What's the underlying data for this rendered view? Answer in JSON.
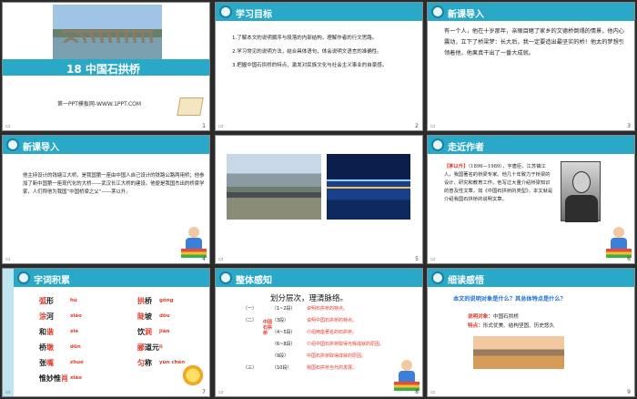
{
  "slide1": {
    "title": "18  中国石拱桥",
    "site": "第一PPT模板网-WWW.1PPT.COM",
    "num": "1"
  },
  "slide2": {
    "heading": "学习目标",
    "num": "2",
    "items": [
      "1.了解本文的说明顺序与段落的内部结构，理解作者的行文思路。",
      "2.学习常见的说明方法，结合具体语句，体会说明文语言的准确性。",
      "3.把握中国石拱桥的特点，激发对民族文化与社会主义事业的自豪感。"
    ]
  },
  "slide3": {
    "heading": "新课导入",
    "num": "3",
    "para": "有一个人，他在十岁那年，亲眼目睹了家乡的文德桥倒塌的情景，他内心震动，立下了桥梁梦：长大后，我一定要造出最坚实的桥！他太的梦想引领着他，他果真干出了一番大成就。"
  },
  "slide4": {
    "heading": "新课导入",
    "num": "4",
    "para": "他主持设计的钱塘江大桥，是我国第一座由中国人自己设计的铁路公路两用桥；他参加了新中国第一座现代化的大桥——武汉长江大桥的建设。他便是我国杰出的桥梁学家，人们称他为我国“中国桥梁之父”——茅以升。"
  },
  "slide5": {
    "num": "5"
  },
  "slide6": {
    "heading": "走近作者",
    "num": "6",
    "tag": "【茅以升】",
    "para": "（1896—1989），字唐臣，江苏镇江人，我国著名的桥梁专家。他几十年致力于桥梁的设计、研究和教育工作。他写过大量介绍桥梁知识的普及性文章，如《中国石拱桥的类型》，本文就是介绍我国石拱桥的说明文章。"
  },
  "slide7": {
    "heading": "字词积累",
    "num": "7",
    "left": [
      {
        "w": "弧形",
        "r": "弧",
        "p": "hú"
      },
      {
        "w": "涂河",
        "r": "涂",
        "p": "xiáo"
      },
      {
        "w": "和谐",
        "r": "谐",
        "p": "xié"
      },
      {
        "w": "桥墩",
        "r": "墩",
        "p": "dūn"
      },
      {
        "w": "张嘴",
        "r": "嘴",
        "p": "zhuó"
      },
      {
        "w": "惟妙惟肖",
        "r": "肖",
        "p": "xiào"
      }
    ],
    "right": [
      {
        "w": "拱桥",
        "r": "拱",
        "p": "gǒng"
      },
      {
        "w": "陡坡",
        "r": "陡",
        "p": "dǒu"
      },
      {
        "w": "饮涧",
        "r": "涧",
        "p": "jiàn"
      },
      {
        "w": "郦道元",
        "r": "郦",
        "p": "lì"
      },
      {
        "w": "匀称",
        "r": "匀",
        "p": "yún chèn"
      }
    ]
  },
  "slide8": {
    "heading": "整体感知",
    "num": "8",
    "head": "划分层次，理清脉络。",
    "vert": "中国石拱桥",
    "rows": [
      {
        "a": "（一）",
        "b": "（1~2段）",
        "c": "说明石拱桥的特点。"
      },
      {
        "a": "（二）",
        "b": "（3段）",
        "c": "说明中国石拱桥的特点。"
      },
      {
        "a": "",
        "b": "（4~5段）",
        "c": "介绍两座著名的石拱桥。"
      },
      {
        "a": "",
        "b": "（6~8段）",
        "c": "介绍中国石拱桥取得光辉成就的原因。"
      },
      {
        "a": "",
        "b": "（9段）",
        "c": "中国石拱桥取得成就的原因。"
      },
      {
        "a": "（三）",
        "b": "（10段）",
        "c": "我国石拱桥当代的发展。"
      }
    ]
  },
  "slide9": {
    "heading": "细读感悟",
    "num": "9",
    "q": "本文的说明对象是什么？其总体特点是什么？",
    "a1label": "说明对象：",
    "a1": "中国石拱桥",
    "a2label": "特点：",
    "a2": "形式优美、结构坚固、历史悠久"
  },
  "colors": {
    "accent": "#2aa8c8",
    "red": "#e23b2b"
  }
}
